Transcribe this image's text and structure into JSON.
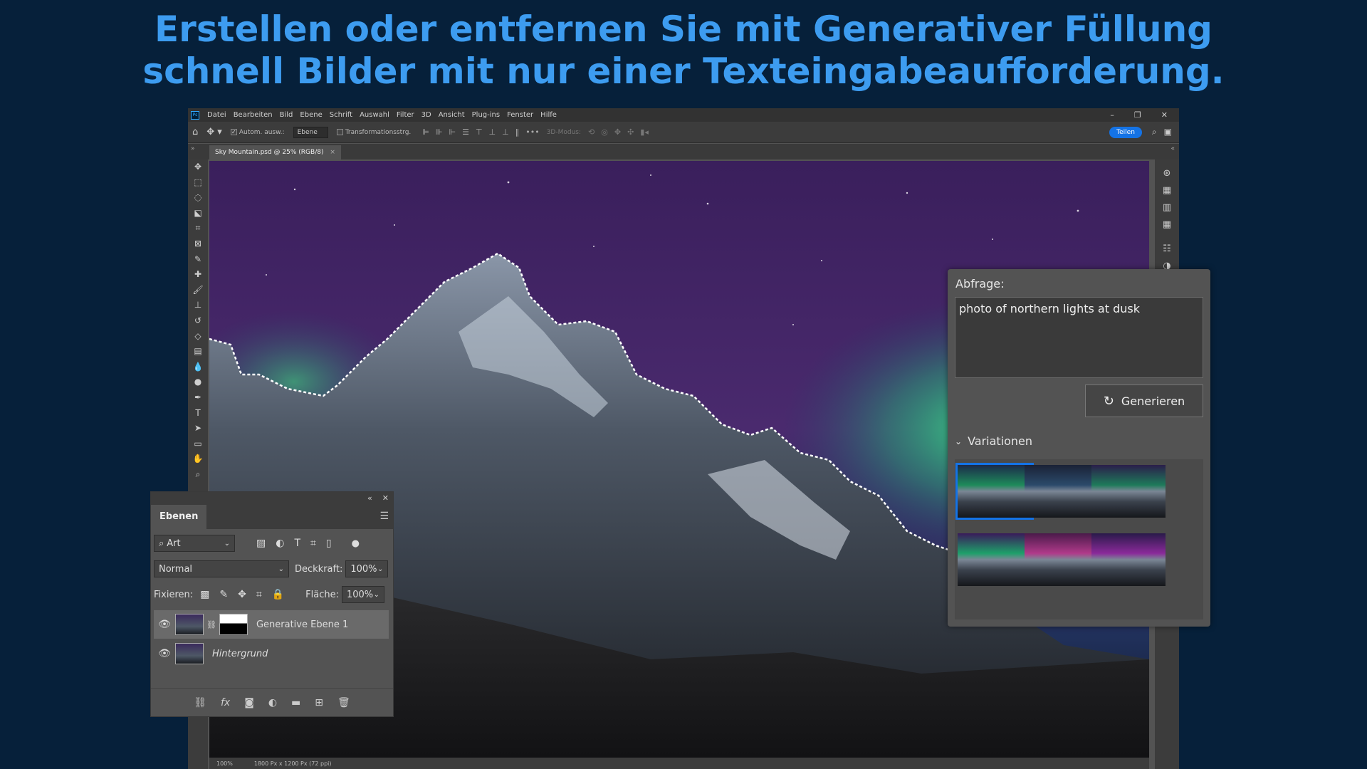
{
  "headline": {
    "line1": "Erstellen oder entfernen Sie mit Generativer Füllung",
    "line2": "schnell Bilder mit nur einer Texteingabeaufforderung."
  },
  "menubar": {
    "logo": "Ps",
    "items": [
      "Datei",
      "Bearbeiten",
      "Bild",
      "Ebene",
      "Schrift",
      "Auswahl",
      "Filter",
      "3D",
      "Ansicht",
      "Plug-ins",
      "Fenster",
      "Hilfe"
    ]
  },
  "options": {
    "auto_select_label": "Autom. ausw.:",
    "auto_select_value": "Ebene",
    "transform_label": "Transformationsstrg.",
    "mode_3d_label": "3D-Modus:",
    "share_label": "Teilen"
  },
  "document": {
    "tab_title": "Sky Mountain.psd @ 25% (RGB/8)",
    "zoom": "100%",
    "size_info": "1800 Px x 1200 Px (72 ppi)"
  },
  "layers_panel": {
    "tab_label": "Ebenen",
    "filter_label": "Art",
    "blend_mode": "Normal",
    "opacity_label": "Deckkraft:",
    "opacity_value": "100%",
    "lock_label": "Fixieren:",
    "fill_label": "Fläche:",
    "fill_value": "100%",
    "layers": [
      {
        "name": "Generative Ebene 1",
        "selected": true
      },
      {
        "name": "Hintergrund",
        "selected": false
      }
    ]
  },
  "gen_panel": {
    "prompt_label": "Abfrage:",
    "prompt_value": "photo of northern lights at dusk",
    "generate_label": "Generieren",
    "variations_label": "Variationen",
    "selected_variation": 1
  },
  "colors": {
    "background": "#06203a",
    "headline": "#3d9cf0",
    "accent": "#1473e6"
  }
}
